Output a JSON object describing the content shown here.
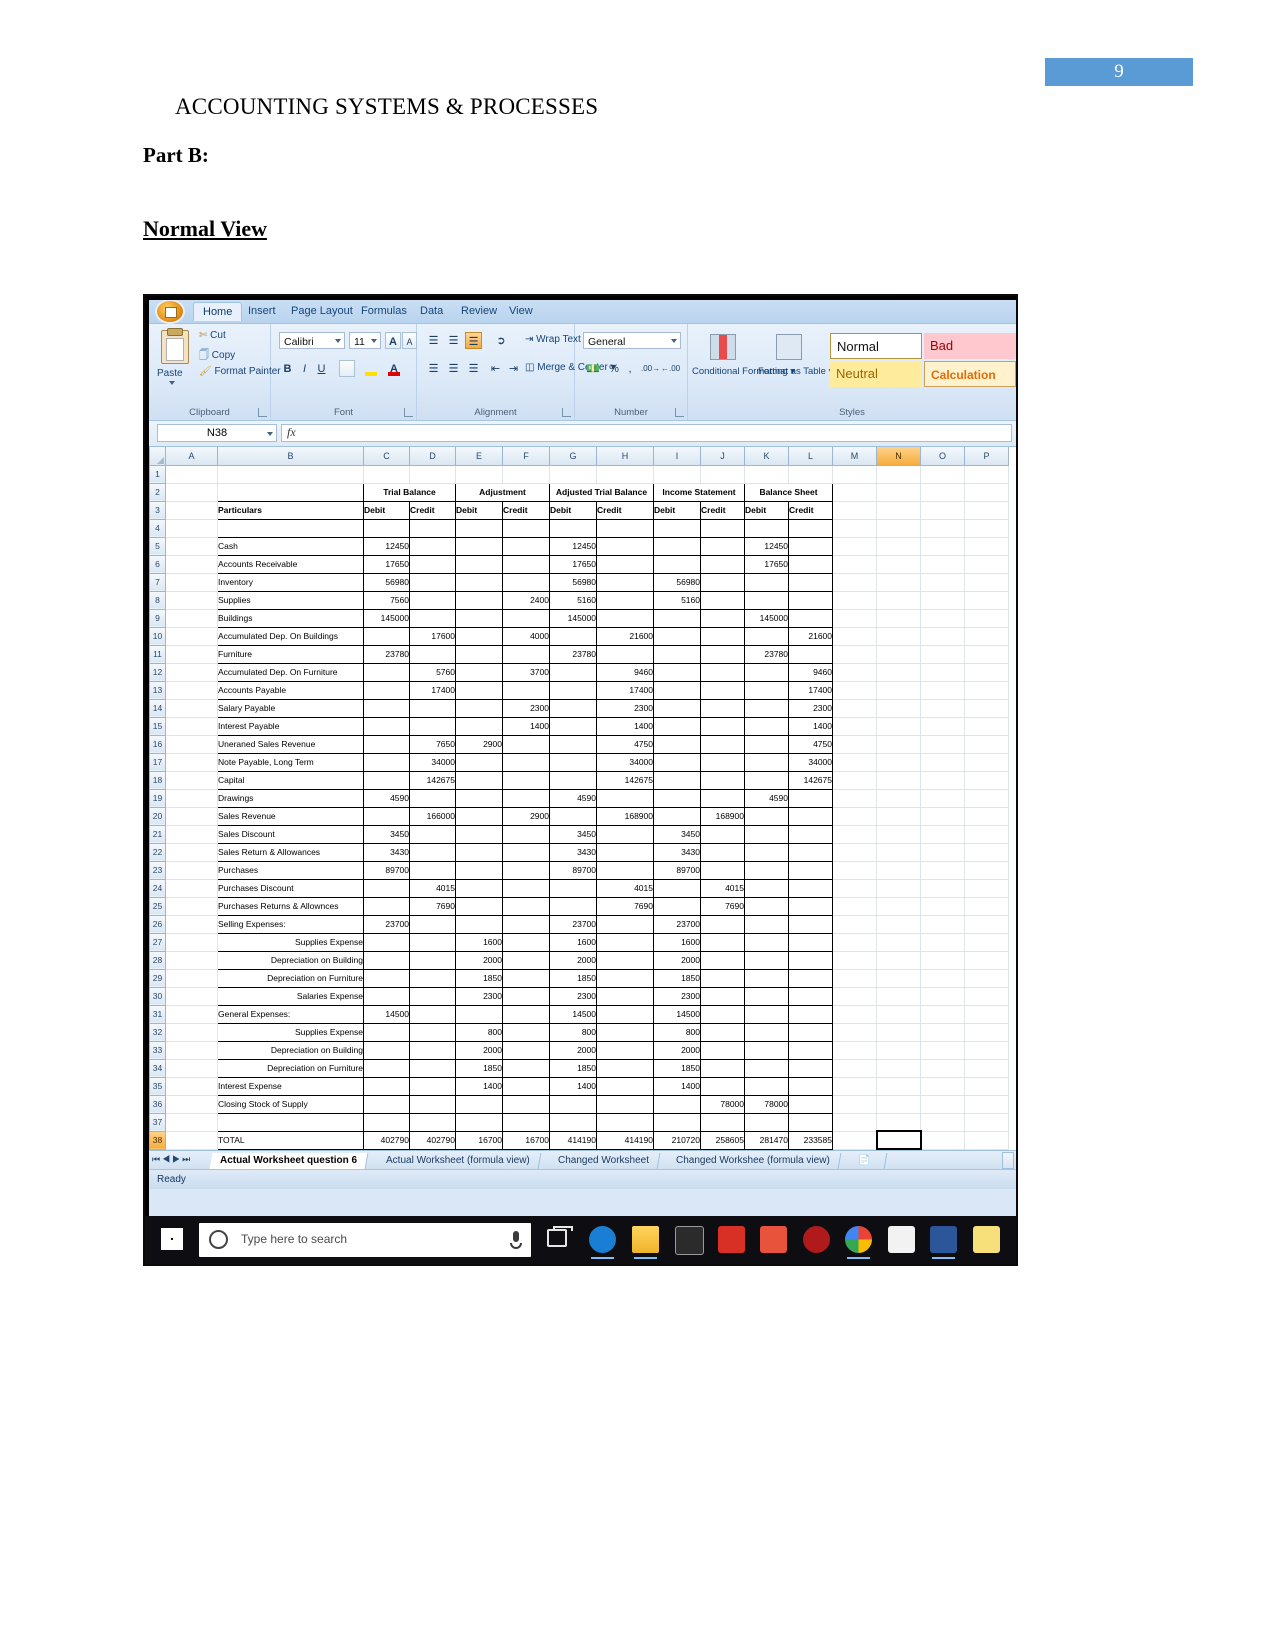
{
  "document": {
    "page_number": "9",
    "title": "ACCOUNTING SYSTEMS & PROCESSES",
    "heading_part": "Part B:",
    "heading_view": "Normal View"
  },
  "colors": {
    "page_badge": "#5b9bd5",
    "ribbon": "#d9e7f7",
    "selected_header": "#f5ad3d",
    "bad_style_bg": "#ffc7ce",
    "neutral_style_bg": "#ffeb9c"
  },
  "excel": {
    "ribbon_tabs": [
      "Home",
      "Insert",
      "Page Layout",
      "Formulas",
      "Data",
      "Review",
      "View"
    ],
    "active_tab": "Home",
    "clipboard": {
      "group_label": "Clipboard",
      "paste_label": "Paste",
      "cut_label": "Cut",
      "copy_label": "Copy",
      "format_painter_label": "Format Painter"
    },
    "font_group": {
      "group_label": "Font",
      "font_name": "Calibri",
      "font_size": "11",
      "grow_font": "A",
      "shrink_font": "A",
      "bold": "B",
      "italic": "I",
      "underline": "U"
    },
    "alignment_group": {
      "group_label": "Alignment",
      "wrap_text": "Wrap Text",
      "merge_center": "Merge & Center"
    },
    "number_group": {
      "group_label": "Number",
      "number_format": "General",
      "percent": "%",
      "comma": ","
    },
    "styles_group": {
      "group_label": "Styles",
      "conditional_formatting": "Conditional Formatting",
      "format_as_table": "Format as Table",
      "cells": [
        "Normal",
        "Bad",
        "Neutral",
        "Calculation"
      ]
    },
    "name_box": "N38",
    "formula_bar_value": "",
    "column_headers": [
      "A",
      "B",
      "C",
      "D",
      "E",
      "F",
      "G",
      "H",
      "I",
      "J",
      "K",
      "L",
      "M",
      "N",
      "O",
      "P"
    ],
    "selected_column": "N",
    "selected_row": "38",
    "selected_cell": "N38",
    "sheet_tabs": [
      "Actual Worksheet question 6",
      "Actual Worksheet (formula view)",
      "Changed Worksheet",
      "Changed Workshee (formula view)"
    ],
    "active_sheet_tab": "Actual Worksheet question 6",
    "status_text": "Ready"
  },
  "taskbar": {
    "search_placeholder": "Type here to search"
  },
  "worksheet": {
    "group_headers": [
      {
        "label": "Trial Balance",
        "cols": [
          "C",
          "D"
        ]
      },
      {
        "label": "Adjustment",
        "cols": [
          "E",
          "F"
        ]
      },
      {
        "label": "Adjusted Trial Balance",
        "cols": [
          "G",
          "H"
        ]
      },
      {
        "label": "Income Statement",
        "cols": [
          "I",
          "J"
        ]
      },
      {
        "label": "Balance Sheet",
        "cols": [
          "K",
          "L"
        ]
      }
    ],
    "sub_headers": [
      "Particulars",
      "Debit",
      "Credit",
      "Debit",
      "Credit",
      "Debit",
      "Credit",
      "Debit",
      "Credit",
      "Debit",
      "Credit"
    ],
    "rows": [
      {
        "r": 1,
        "b": "",
        "vals": [
          "",
          "",
          "",
          "",
          "",
          "",
          "",
          "",
          "",
          ""
        ],
        "blank": true
      },
      {
        "r": 4,
        "b": "",
        "vals": [
          "",
          "",
          "",
          "",
          "",
          "",
          "",
          "",
          "",
          ""
        ]
      },
      {
        "r": 5,
        "b": "Cash",
        "vals": [
          "12450",
          "",
          "",
          "",
          "12450",
          "",
          "",
          "",
          "12450",
          ""
        ]
      },
      {
        "r": 6,
        "b": "Accounts Receivable",
        "vals": [
          "17650",
          "",
          "",
          "",
          "17650",
          "",
          "",
          "",
          "17650",
          ""
        ]
      },
      {
        "r": 7,
        "b": "Inventory",
        "vals": [
          "56980",
          "",
          "",
          "",
          "56980",
          "",
          "56980",
          "",
          "",
          ""
        ]
      },
      {
        "r": 8,
        "b": "Supplies",
        "vals": [
          "7560",
          "",
          "",
          "2400",
          "5160",
          "",
          "5160",
          "",
          "",
          ""
        ]
      },
      {
        "r": 9,
        "b": "Buildings",
        "vals": [
          "145000",
          "",
          "",
          "",
          "145000",
          "",
          "",
          "",
          "145000",
          ""
        ]
      },
      {
        "r": 10,
        "b": "Accumulated Dep. On Buildings",
        "vals": [
          "",
          "17600",
          "",
          "4000",
          "",
          "21600",
          "",
          "",
          "",
          "21600"
        ]
      },
      {
        "r": 11,
        "b": "Furniture",
        "vals": [
          "23780",
          "",
          "",
          "",
          "23780",
          "",
          "",
          "",
          "23780",
          ""
        ]
      },
      {
        "r": 12,
        "b": "Accumulated Dep. On Furniture",
        "vals": [
          "",
          "5760",
          "",
          "3700",
          "",
          "9460",
          "",
          "",
          "",
          "9460"
        ]
      },
      {
        "r": 13,
        "b": "Accounts Payable",
        "vals": [
          "",
          "17400",
          "",
          "",
          "",
          "17400",
          "",
          "",
          "",
          "17400"
        ]
      },
      {
        "r": 14,
        "b": "Salary Payable",
        "vals": [
          "",
          "",
          "",
          "2300",
          "",
          "2300",
          "",
          "",
          "",
          "2300"
        ]
      },
      {
        "r": 15,
        "b": "Interest Payable",
        "vals": [
          "",
          "",
          "",
          "1400",
          "",
          "1400",
          "",
          "",
          "",
          "1400"
        ]
      },
      {
        "r": 16,
        "b": "Uneraned Sales Revenue",
        "vals": [
          "",
          "7650",
          "2900",
          "",
          "",
          "4750",
          "",
          "",
          "",
          "4750"
        ]
      },
      {
        "r": 17,
        "b": "Note Payable, Long Term",
        "vals": [
          "",
          "34000",
          "",
          "",
          "",
          "34000",
          "",
          "",
          "",
          "34000"
        ]
      },
      {
        "r": 18,
        "b": "Capital",
        "vals": [
          "",
          "142675",
          "",
          "",
          "",
          "142675",
          "",
          "",
          "",
          "142675"
        ]
      },
      {
        "r": 19,
        "b": "Drawings",
        "vals": [
          "4590",
          "",
          "",
          "",
          "4590",
          "",
          "",
          "",
          "4590",
          ""
        ]
      },
      {
        "r": 20,
        "b": "Sales Revenue",
        "vals": [
          "",
          "166000",
          "",
          "2900",
          "",
          "168900",
          "",
          "168900",
          "",
          ""
        ]
      },
      {
        "r": 21,
        "b": "Sales Discount",
        "vals": [
          "3450",
          "",
          "",
          "",
          "3450",
          "",
          "3450",
          "",
          "",
          ""
        ]
      },
      {
        "r": 22,
        "b": "Sales Return & Allowances",
        "vals": [
          "3430",
          "",
          "",
          "",
          "3430",
          "",
          "3430",
          "",
          "",
          ""
        ]
      },
      {
        "r": 23,
        "b": "Purchases",
        "vals": [
          "89700",
          "",
          "",
          "",
          "89700",
          "",
          "89700",
          "",
          "",
          ""
        ]
      },
      {
        "r": 24,
        "b": "Purchases Discount",
        "vals": [
          "",
          "4015",
          "",
          "",
          "",
          "4015",
          "",
          "4015",
          "",
          ""
        ]
      },
      {
        "r": 25,
        "b": "Purchases Returns & Allownces",
        "vals": [
          "",
          "7690",
          "",
          "",
          "",
          "7690",
          "",
          "7690",
          "",
          ""
        ]
      },
      {
        "r": 26,
        "b": "Selling Expenses:",
        "vals": [
          "23700",
          "",
          "",
          "",
          "23700",
          "",
          "23700",
          "",
          "",
          ""
        ]
      },
      {
        "r": 27,
        "b": "Supplies Expense",
        "indent": true,
        "vals": [
          "",
          "",
          "1600",
          "",
          "1600",
          "",
          "1600",
          "",
          "",
          ""
        ]
      },
      {
        "r": 28,
        "b": "Depreciation on Building",
        "indent": true,
        "vals": [
          "",
          "",
          "2000",
          "",
          "2000",
          "",
          "2000",
          "",
          "",
          ""
        ]
      },
      {
        "r": 29,
        "b": "Depreciation on Furniture",
        "indent": true,
        "vals": [
          "",
          "",
          "1850",
          "",
          "1850",
          "",
          "1850",
          "",
          "",
          ""
        ]
      },
      {
        "r": 30,
        "b": "Salaries Expense",
        "indent": true,
        "vals": [
          "",
          "",
          "2300",
          "",
          "2300",
          "",
          "2300",
          "",
          "",
          ""
        ]
      },
      {
        "r": 31,
        "b": "General Expenses:",
        "vals": [
          "14500",
          "",
          "",
          "",
          "14500",
          "",
          "14500",
          "",
          "",
          ""
        ]
      },
      {
        "r": 32,
        "b": "Supplies Expense",
        "indent": true,
        "vals": [
          "",
          "",
          "800",
          "",
          "800",
          "",
          "800",
          "",
          "",
          ""
        ]
      },
      {
        "r": 33,
        "b": "Depreciation on Building",
        "indent": true,
        "vals": [
          "",
          "",
          "2000",
          "",
          "2000",
          "",
          "2000",
          "",
          "",
          ""
        ]
      },
      {
        "r": 34,
        "b": "Depreciation on Furniture",
        "indent": true,
        "vals": [
          "",
          "",
          "1850",
          "",
          "1850",
          "",
          "1850",
          "",
          "",
          ""
        ]
      },
      {
        "r": 35,
        "b": "Interest Expense",
        "vals": [
          "",
          "",
          "1400",
          "",
          "1400",
          "",
          "1400",
          "",
          "",
          ""
        ]
      },
      {
        "r": 36,
        "b": "Closing Stock of Supply",
        "vals": [
          "",
          "",
          "",
          "",
          "",
          "",
          "",
          "78000",
          "78000",
          ""
        ]
      },
      {
        "r": 37,
        "b": "",
        "vals": [
          "",
          "",
          "",
          "",
          "",
          "",
          "",
          "",
          "",
          ""
        ]
      },
      {
        "r": 38,
        "b": "TOTAL",
        "total": true,
        "vals": [
          "402790",
          "402790",
          "16700",
          "16700",
          "414190",
          "414190",
          "210720",
          "258605",
          "281470",
          "233585"
        ]
      }
    ]
  }
}
